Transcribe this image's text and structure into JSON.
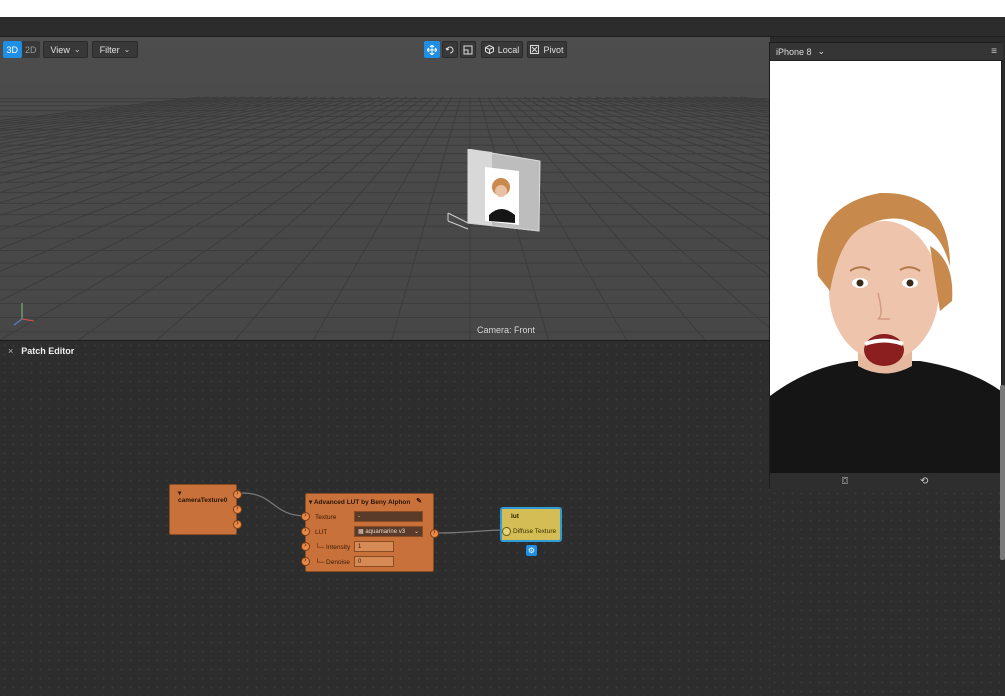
{
  "toolbar": {
    "mode_3d": "3D",
    "mode_2d": "2D",
    "view_label": "View",
    "filter_label": "Filter",
    "local_label": "Local",
    "pivot_label": "Pivot"
  },
  "viewport": {
    "camera_label": "Camera: Front"
  },
  "simulator": {
    "device_label": "iPhone 8"
  },
  "patch_editor": {
    "title": "Patch Editor",
    "close_glyph": "×",
    "camera_node": {
      "title": "cameraTexture0"
    },
    "lut_adv_node": {
      "title": "Advanced LUT by Beny Alphon",
      "ports": {
        "texture": "Texture",
        "lut": "LUT",
        "intensity": "└─ Intensity",
        "denoise": "└─ Denoise"
      },
      "texture_value": "-",
      "lut_value": "aquamarine v3",
      "intensity_value": "1",
      "denoise_value": "0"
    },
    "lut_node": {
      "title": "lut",
      "port": "Diffuse Texture"
    }
  },
  "colors": {
    "accent": "#1f8fe6",
    "patch_orange": "#c8713a",
    "material_yellow": "#d4bd55"
  }
}
